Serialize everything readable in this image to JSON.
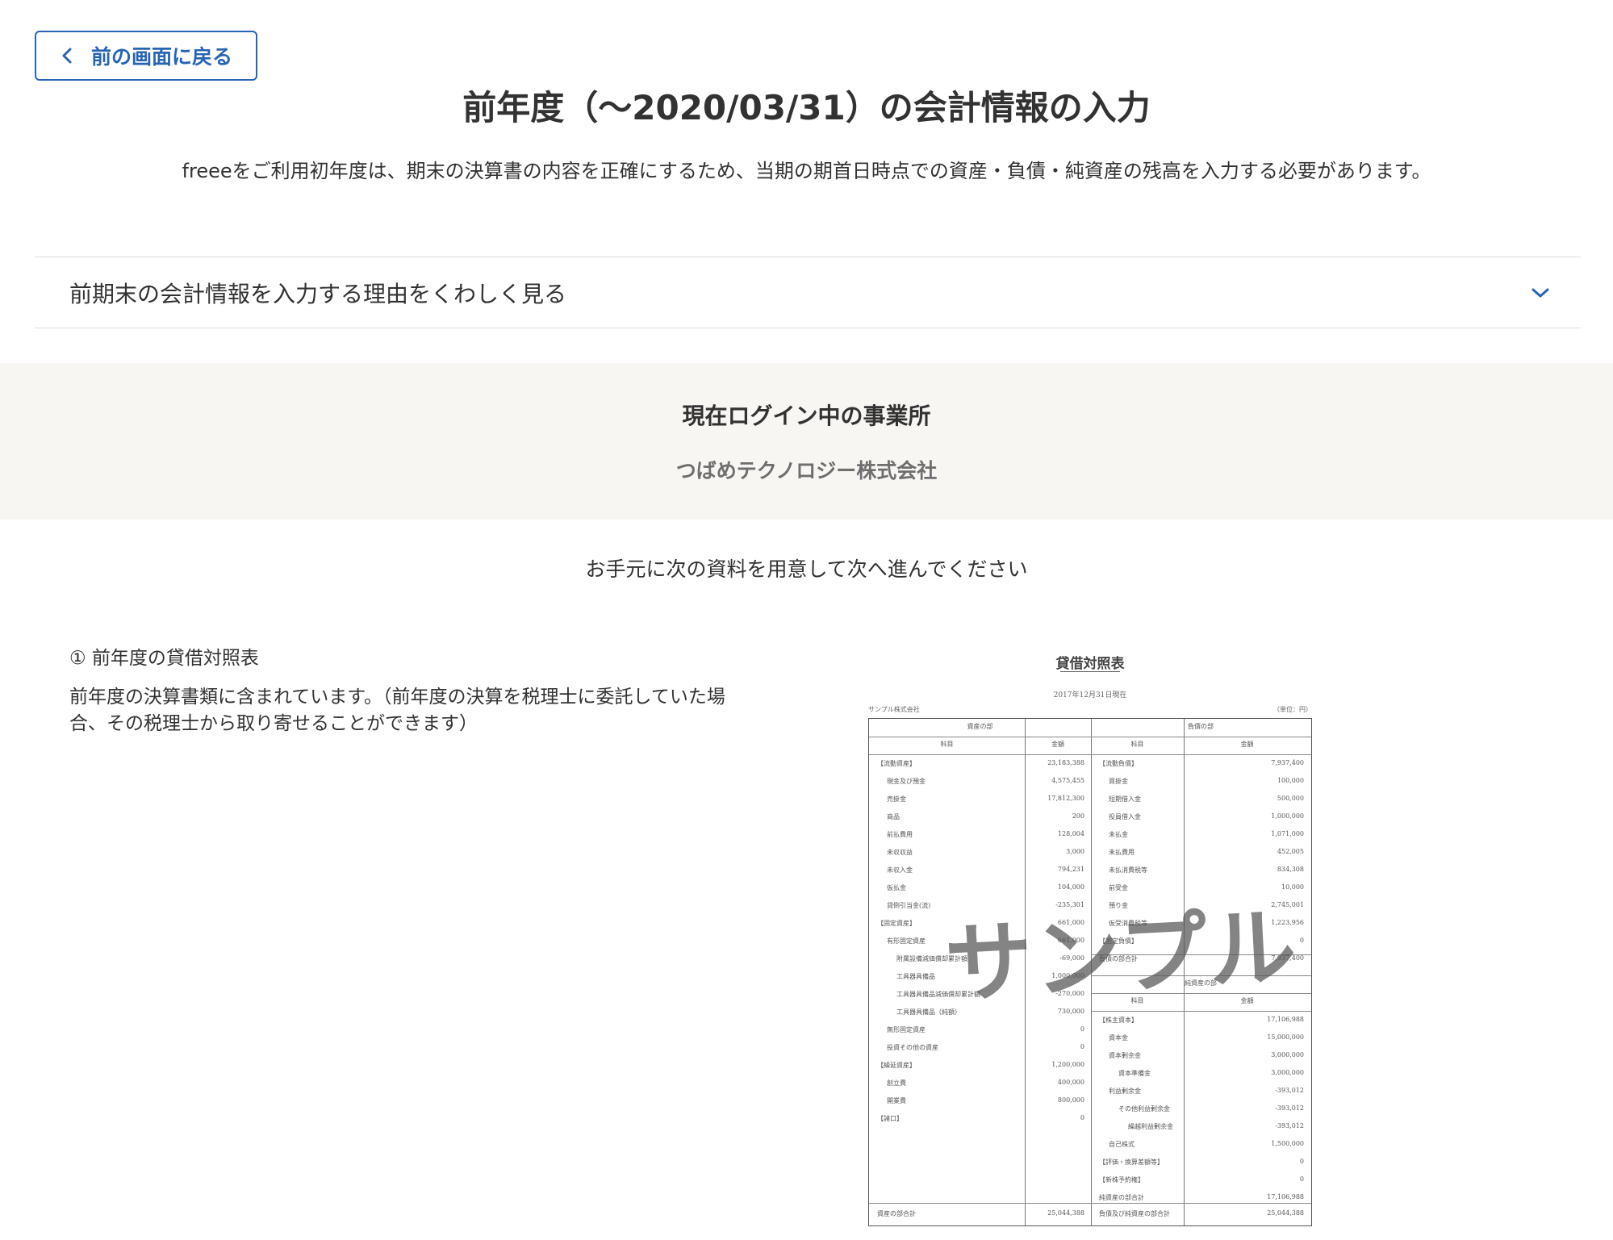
{
  "header": {
    "back_button": "前の画面に戻る",
    "back_icon": "chevron-left-icon"
  },
  "title": "前年度（〜2020/03/31）の会計情報の入力",
  "lead": "freeeをご利用初年度は、期末の決算書の内容を正確にするため、当期の期首日時点での資産・負債・純資産の残高を入力する必要があります。",
  "accordion": {
    "label": "前期末の会計情報を入力する理由をくわしく見る",
    "icon": "chevron-down-icon"
  },
  "office": {
    "heading": "現在ログイン中の事業所",
    "name": "つばめテクノロジー株式会社"
  },
  "instruction": "お手元に次の資料を用意して次へ進んでください",
  "item": {
    "title": "① 前年度の貸借対照表",
    "description": "前年度の決算書類に含まれています。（前年度の決算を税理士に委託していた場合、その税理士から取り寄せることができます）"
  },
  "sample_doc": {
    "title": "貸借対照表",
    "date": "2017年12月31日現在",
    "company": "サンプル株式会社",
    "unit": "（単位：円）",
    "watermark": "サンプル",
    "asset_header": "資産の部",
    "liability_header": "負債の部",
    "equity_header": "純資産の部",
    "col_subject": "科目",
    "col_amount": "金額",
    "assets": [
      {
        "label": "【流動資産】",
        "value": "23,183,388"
      },
      {
        "label": "現金及び預金",
        "value": "4,575,455"
      },
      {
        "label": "売掛金",
        "value": "17,812,300"
      },
      {
        "label": "商品",
        "value": "200"
      },
      {
        "label": "前払費用",
        "value": "128,004"
      },
      {
        "label": "未収収益",
        "value": "3,000"
      },
      {
        "label": "未収入金",
        "value": "794,231"
      },
      {
        "label": "仮払金",
        "value": "104,000"
      },
      {
        "label": "貸倒引当金(流)",
        "value": "-235,301"
      },
      {
        "label": "【固定資産】",
        "value": "661,000"
      },
      {
        "label": "有形固定資産",
        "value": "661,000"
      },
      {
        "label": "附属設備減価償却累計額",
        "value": "-69,000"
      },
      {
        "label": "工具器具備品",
        "value": "1,000,000"
      },
      {
        "label": "工具器具備品減価償却累計額",
        "value": "-270,000"
      },
      {
        "label": "工具器具備品（純額）",
        "value": "730,000"
      },
      {
        "label": "無形固定資産",
        "value": "0"
      },
      {
        "label": "投資その他の資産",
        "value": "0"
      },
      {
        "label": "【繰延資産】",
        "value": "1,200,000"
      },
      {
        "label": "創立費",
        "value": "400,000"
      },
      {
        "label": "開業費",
        "value": "800,000"
      },
      {
        "label": "【諸口】",
        "value": "0"
      }
    ],
    "liabilities": [
      {
        "label": "【流動負債】",
        "value": "7,937,400"
      },
      {
        "label": "買掛金",
        "value": "100,000"
      },
      {
        "label": "短期借入金",
        "value": "500,000"
      },
      {
        "label": "役員借入金",
        "value": "1,000,000"
      },
      {
        "label": "未払金",
        "value": "1,071,000"
      },
      {
        "label": "未払費用",
        "value": "452,005"
      },
      {
        "label": "未払消費税等",
        "value": "834,308"
      },
      {
        "label": "前受金",
        "value": "10,000"
      },
      {
        "label": "預り金",
        "value": "2,745,001"
      },
      {
        "label": "仮受消費税等",
        "value": "1,223,956"
      },
      {
        "label": "【固定負債】",
        "value": "0"
      },
      {
        "label": "負債の部合計",
        "value": "7,937,400"
      }
    ],
    "equity": [
      {
        "label": "【株主資本】",
        "value": "17,106,988"
      },
      {
        "label": "資本金",
        "value": "15,000,000"
      },
      {
        "label": "資本剰余金",
        "value": "3,000,000"
      },
      {
        "label": "資本準備金",
        "value": "3,000,000"
      },
      {
        "label": "利益剰余金",
        "value": "-393,012"
      },
      {
        "label": "その他利益剰余金",
        "value": "-393,012"
      },
      {
        "label": "繰越利益剰余金",
        "value": "-393,012"
      },
      {
        "label": "自己株式",
        "value": "1,500,000"
      },
      {
        "label": "【評価・換算差額等】",
        "value": "0"
      },
      {
        "label": "【新株予約権】",
        "value": "0"
      },
      {
        "label": "純資産の部合計",
        "value": "17,106,988"
      }
    ],
    "asset_total_label": "資産の部合計",
    "asset_total_value": "25,044,388",
    "liab_equity_total_label": "負債及び純資産の部合計",
    "liab_equity_total_value": "25,044,388"
  }
}
